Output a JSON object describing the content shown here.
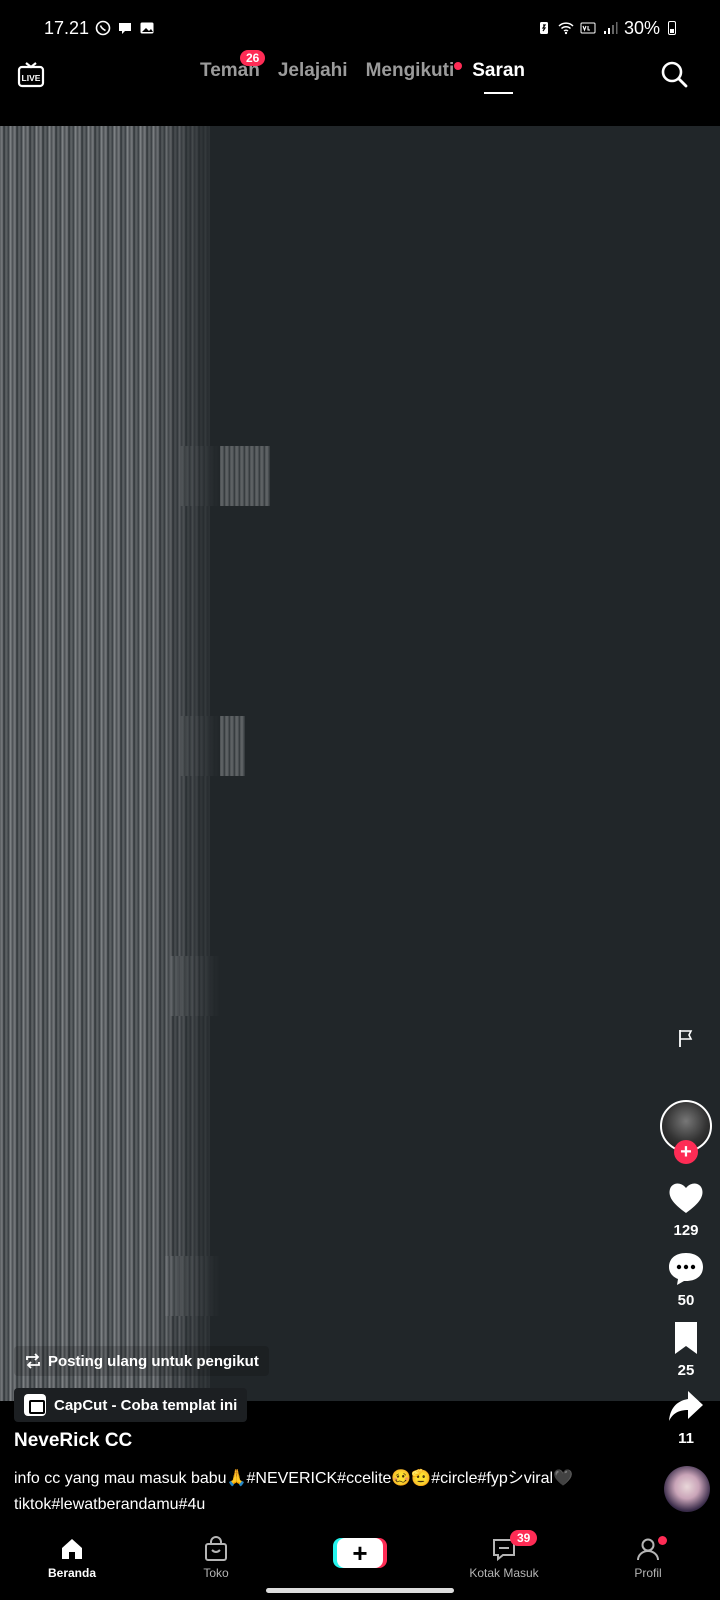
{
  "status_bar": {
    "time": "17.21",
    "battery": "30%",
    "left_icons": [
      "whatsapp-icon",
      "chat-icon",
      "gallery-icon"
    ],
    "right_icons": [
      "battery-saver-icon",
      "wifi-icon",
      "volte-icon",
      "signal-icon"
    ]
  },
  "top_nav": {
    "live_label": "LIVE",
    "tabs": [
      {
        "label": "Teman",
        "badge": "26"
      },
      {
        "label": "Jelajahi"
      },
      {
        "label": "Mengikuti",
        "dot": true
      },
      {
        "label": "Saran",
        "active": true
      }
    ]
  },
  "video": {
    "author": "NeveRick CC",
    "caption_line1": "info cc yang mau masuk babu🙏#NEVERICK#ccelite🥴🫡#circle#fypシviral🖤",
    "caption_line2": "tiktok#lewatberandamu#4u",
    "repost_label": "Posting ulang untuk pengikut",
    "capcut_label": "CapCut - Coba templat ini"
  },
  "actions": {
    "likes": "129",
    "comments": "50",
    "saves": "25",
    "shares": "11"
  },
  "bottom_nav": {
    "home": "Beranda",
    "shop": "Toko",
    "inbox": "Kotak Masuk",
    "inbox_badge": "39",
    "profile": "Profil"
  },
  "colors": {
    "accent": "#fe2c55",
    "cyan": "#25f4ee",
    "video_bg": "#212629"
  }
}
